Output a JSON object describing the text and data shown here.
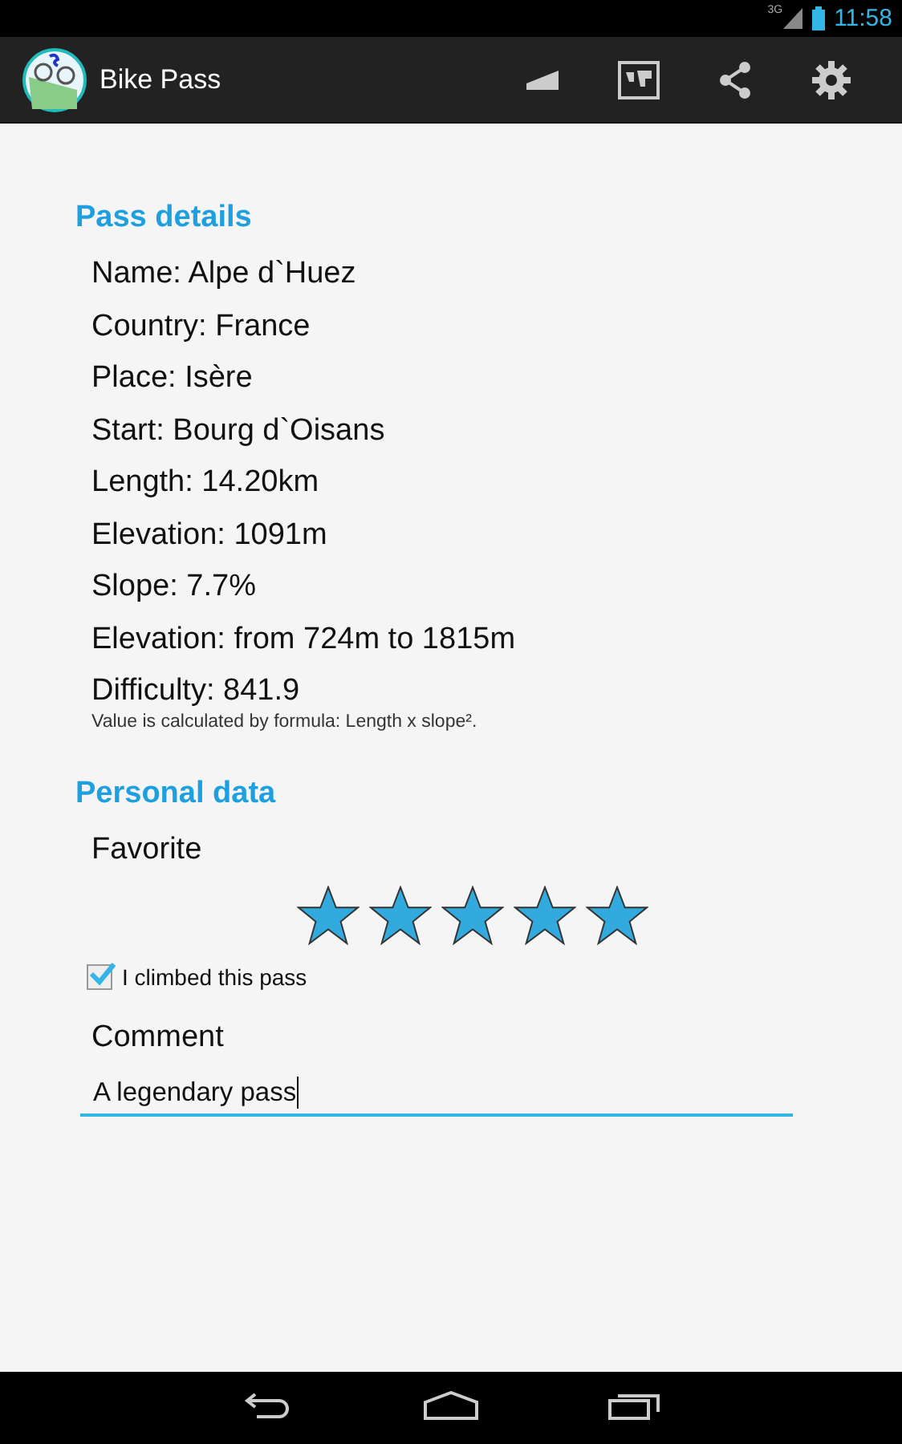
{
  "status_bar": {
    "network": "3G",
    "time": "11:58"
  },
  "app_bar": {
    "title": "Bike Pass"
  },
  "pass_details": {
    "heading": "Pass details",
    "lines": [
      "Name: Alpe d`Huez",
      "Country: France",
      "Place: Isère",
      "Start: Bourg d`Oisans",
      "Length: 14.20km",
      "Elevation: 1091m",
      "Slope: 7.7%",
      "Elevation: from 724m to 1815m",
      "Difficulty: 841.9"
    ],
    "note": "Value is calculated by formula: Length x slope²."
  },
  "personal_data": {
    "heading": "Personal data",
    "favorite_label": "Favorite",
    "stars": 5,
    "climbed": {
      "label": "I climbed this pass",
      "checked": true
    },
    "comment_label": "Comment",
    "comment": {
      "value": "A legendary pass"
    }
  }
}
